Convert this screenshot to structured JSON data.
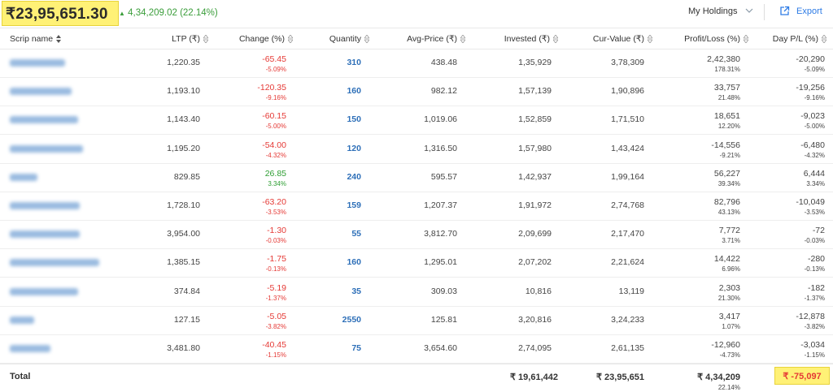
{
  "summary": {
    "total_value": "₹23,95,651.30",
    "change_arrow": "▲",
    "change_text": "4,34,209.02 (22.14%)",
    "holdings_select": "My Holdings",
    "export_label": "Export"
  },
  "columns": {
    "scrip": "Scrip name",
    "ltp": "LTP (₹)",
    "change": "Change (%)",
    "qty": "Quantity",
    "avg": "Avg-Price (₹)",
    "invested": "Invested (₹)",
    "cur": "Cur-Value (₹)",
    "pl": "Profit/Loss (%)",
    "day": "Day P/L (%)"
  },
  "rows": [
    {
      "ltp": "1,220.35",
      "chg": "-65.45",
      "chg_pct": "-5.09%",
      "qty": "310",
      "avg": "438.48",
      "inv": "1,35,929",
      "cur": "3,78,309",
      "pl": "2,42,380",
      "pl_pct": "178.31%",
      "day": "-20,290",
      "day_pct": "-5.09%"
    },
    {
      "ltp": "1,193.10",
      "chg": "-120.35",
      "chg_pct": "-9.16%",
      "qty": "160",
      "avg": "982.12",
      "inv": "1,57,139",
      "cur": "1,90,896",
      "pl": "33,757",
      "pl_pct": "21.48%",
      "day": "-19,256",
      "day_pct": "-9.16%"
    },
    {
      "ltp": "1,143.40",
      "chg": "-60.15",
      "chg_pct": "-5.00%",
      "qty": "150",
      "avg": "1,019.06",
      "inv": "1,52,859",
      "cur": "1,71,510",
      "pl": "18,651",
      "pl_pct": "12.20%",
      "day": "-9,023",
      "day_pct": "-5.00%"
    },
    {
      "ltp": "1,195.20",
      "chg": "-54.00",
      "chg_pct": "-4.32%",
      "qty": "120",
      "avg": "1,316.50",
      "inv": "1,57,980",
      "cur": "1,43,424",
      "pl": "-14,556",
      "pl_pct": "-9.21%",
      "day": "-6,480",
      "day_pct": "-4.32%"
    },
    {
      "ltp": "829.85",
      "chg": "26.85",
      "chg_pct": "3.34%",
      "qty": "240",
      "avg": "595.57",
      "inv": "1,42,937",
      "cur": "1,99,164",
      "pl": "56,227",
      "pl_pct": "39.34%",
      "day": "6,444",
      "day_pct": "3.34%"
    },
    {
      "ltp": "1,728.10",
      "chg": "-63.20",
      "chg_pct": "-3.53%",
      "qty": "159",
      "avg": "1,207.37",
      "inv": "1,91,972",
      "cur": "2,74,768",
      "pl": "82,796",
      "pl_pct": "43.13%",
      "day": "-10,049",
      "day_pct": "-3.53%"
    },
    {
      "ltp": "3,954.00",
      "chg": "-1.30",
      "chg_pct": "-0.03%",
      "qty": "55",
      "avg": "3,812.70",
      "inv": "2,09,699",
      "cur": "2,17,470",
      "pl": "7,772",
      "pl_pct": "3.71%",
      "day": "-72",
      "day_pct": "-0.03%"
    },
    {
      "ltp": "1,385.15",
      "chg": "-1.75",
      "chg_pct": "-0.13%",
      "qty": "160",
      "avg": "1,295.01",
      "inv": "2,07,202",
      "cur": "2,21,624",
      "pl": "14,422",
      "pl_pct": "6.96%",
      "day": "-280",
      "day_pct": "-0.13%"
    },
    {
      "ltp": "374.84",
      "chg": "-5.19",
      "chg_pct": "-1.37%",
      "qty": "35",
      "avg": "309.03",
      "inv": "10,816",
      "cur": "13,119",
      "pl": "2,303",
      "pl_pct": "21.30%",
      "day": "-182",
      "day_pct": "-1.37%"
    },
    {
      "ltp": "127.15",
      "chg": "-5.05",
      "chg_pct": "-3.82%",
      "qty": "2550",
      "avg": "125.81",
      "inv": "3,20,816",
      "cur": "3,24,233",
      "pl": "3,417",
      "pl_pct": "1.07%",
      "day": "-12,878",
      "day_pct": "-3.82%"
    },
    {
      "ltp": "3,481.80",
      "chg": "-40.45",
      "chg_pct": "-1.15%",
      "qty": "75",
      "avg": "3,654.60",
      "inv": "2,74,095",
      "cur": "2,61,135",
      "pl": "-12,960",
      "pl_pct": "-4.73%",
      "day": "-3,034",
      "day_pct": "-1.15%"
    }
  ],
  "footer": {
    "label": "Total",
    "invested": "₹ 19,61,442",
    "cur_value": "₹ 23,95,651",
    "pl": "₹ 4,34,209",
    "pl_pct": "22.14%",
    "day": "₹ -75,097"
  },
  "colors": {
    "negative": "#e53935",
    "positive": "#2e9e33",
    "link": "#2d7be5",
    "highlight": "#fff176"
  },
  "icons": {
    "sort": "sort-icon",
    "chevron": "chevron-down-icon",
    "export": "export-icon"
  }
}
